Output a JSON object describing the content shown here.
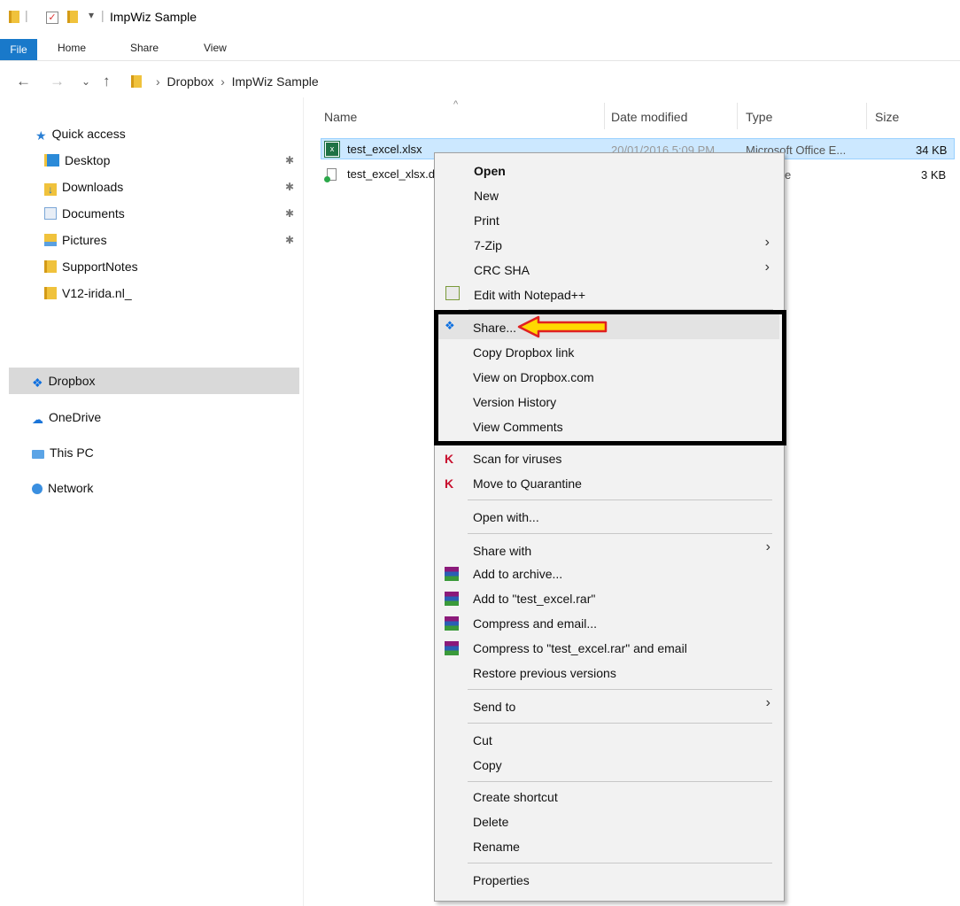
{
  "window": {
    "title": "ImpWiz Sample"
  },
  "ribbon": {
    "tabs": [
      "File",
      "Home",
      "Share",
      "View"
    ]
  },
  "address": {
    "path": [
      "Dropbox",
      "ImpWiz Sample"
    ]
  },
  "nav": {
    "quick_access": "Quick access",
    "pinned": [
      "Desktop",
      "Downloads",
      "Documents",
      "Pictures"
    ],
    "folders": [
      "SupportNotes",
      "V12-irida.nl_"
    ],
    "dropbox": "Dropbox",
    "onedrive": "OneDrive",
    "thispc": "This PC",
    "network": "Network"
  },
  "filelist": {
    "columns": [
      "Name",
      "Date modified",
      "Type",
      "Size"
    ],
    "rows": [
      {
        "name": "test_excel.xlsx",
        "date": "20/01/2016 5:09 PM",
        "type": "Microsoft Office E...",
        "size": "34 KB"
      },
      {
        "name": "test_excel_xlsx.d",
        "date": "",
        "type": "e",
        "size": "3 KB"
      }
    ]
  },
  "context_menu": {
    "group1": [
      "Open",
      "New",
      "Print",
      "7-Zip",
      "CRC SHA",
      "Edit with Notepad++"
    ],
    "dropbox": [
      "Share...",
      "Copy Dropbox link",
      "View on Dropbox.com",
      "Version History",
      "View Comments"
    ],
    "kaspersky": [
      "Scan for viruses",
      "Move to Quarantine"
    ],
    "open_with": "Open with...",
    "share_group": [
      "Share with",
      "Add to archive...",
      "Add to \"test_excel.rar\"",
      "Compress and email...",
      "Compress to \"test_excel.rar\" and email",
      "Restore previous versions"
    ],
    "send_to": "Send to",
    "clipboard": [
      "Cut",
      "Copy"
    ],
    "manage": [
      "Create shortcut",
      "Delete",
      "Rename"
    ],
    "properties": "Properties"
  },
  "colors": {
    "accent": "#1979ca",
    "selection": "#cce8ff",
    "highlight_box": "#000000",
    "arrow": "#ffd800",
    "arrow_outline": "#e02020"
  }
}
